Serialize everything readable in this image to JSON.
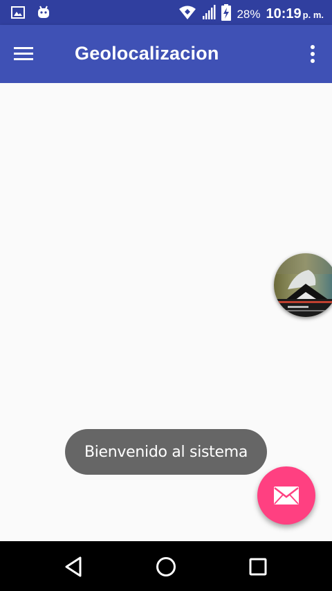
{
  "status_bar": {
    "battery_percent": "28%",
    "time": "10:19",
    "time_suffix": "p. m.",
    "icons": [
      "image-notification-icon",
      "android-notification-icon",
      "wifi-icon",
      "signal-icon",
      "battery-charging-icon"
    ]
  },
  "app_bar": {
    "title": "Geolocalizacion",
    "menu_icon": "hamburger-menu-icon",
    "overflow_icon": "more-vert-icon"
  },
  "toast": {
    "message": "Bienvenido al sistema"
  },
  "fab": {
    "icon": "email-icon",
    "color": "#ff4081"
  },
  "navigation_bar": {
    "icons": [
      "back-icon",
      "home-icon",
      "recents-icon"
    ]
  },
  "colors": {
    "primary": "#3f51b5",
    "primary_dark": "#303f9f",
    "accent": "#ff4081",
    "background": "#fafafa",
    "toast": "#666666"
  }
}
